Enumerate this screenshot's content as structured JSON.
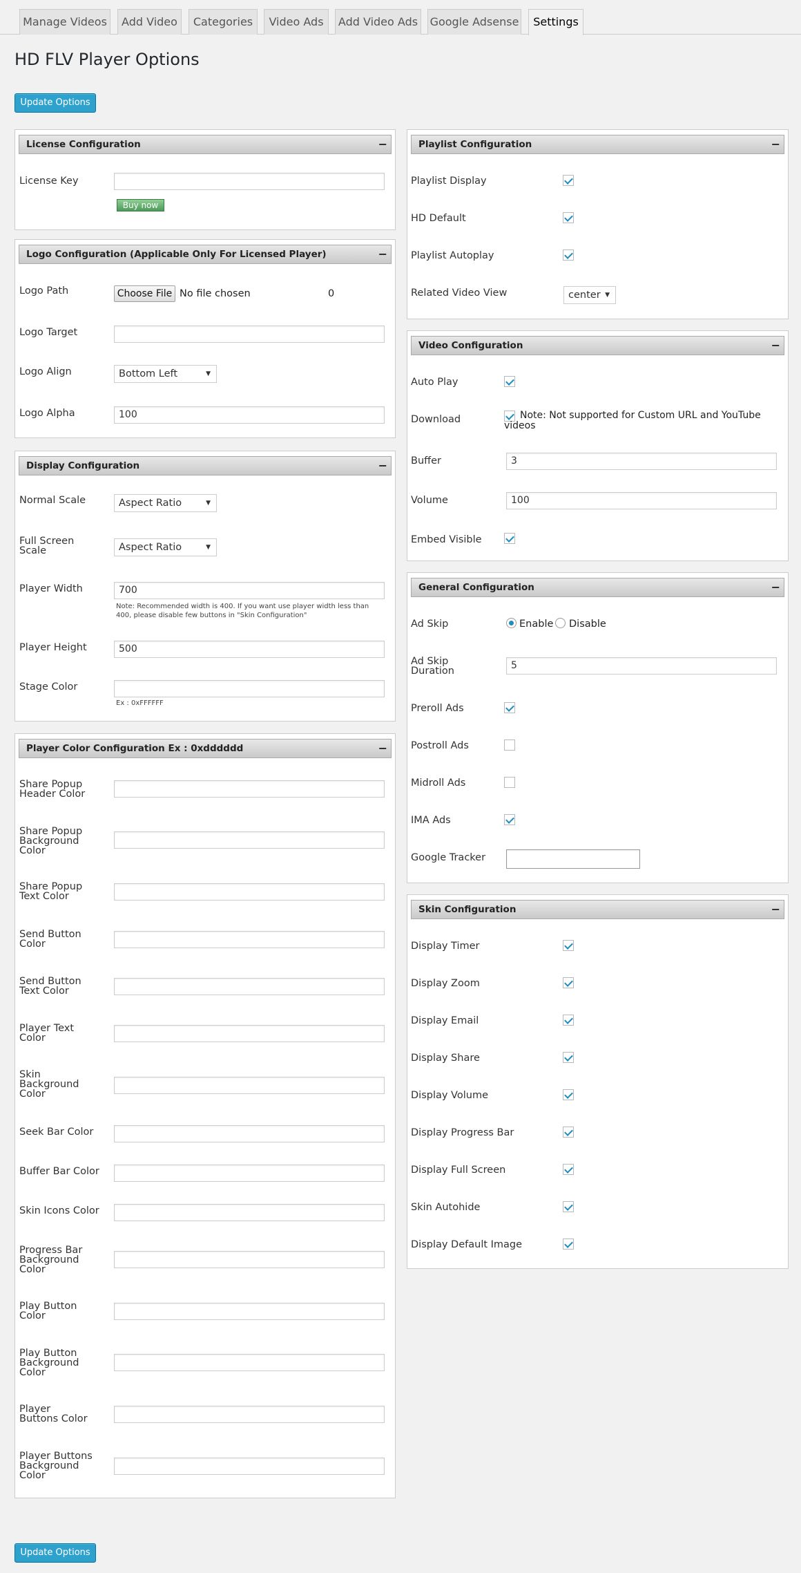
{
  "tabs": [
    "Manage Videos",
    "Add Video",
    "Categories",
    "Video Ads",
    "Add Video Ads",
    "Google Adsense",
    "Settings"
  ],
  "title": "HD FLV Player Options",
  "update_label": "Update Options",
  "license": {
    "title": "License Configuration",
    "key_label": "License Key",
    "key_value": "",
    "buy": "Buy now"
  },
  "logo": {
    "title": "Logo Configuration (Applicable Only For Licensed Player)",
    "path_label": "Logo Path",
    "choose": "Choose File",
    "no_file": "No file chosen",
    "zero": "0",
    "target_label": "Logo Target",
    "target_value": "",
    "align_label": "Logo Align",
    "align_value": "Bottom Left",
    "alpha_label": "Logo Alpha",
    "alpha_value": "100"
  },
  "display": {
    "title": "Display Configuration",
    "normal_label": "Normal Scale",
    "normal_value": "Aspect Ratio",
    "full_label": "Full Screen Scale",
    "full_value": "Aspect Ratio",
    "width_label": "Player Width",
    "width_value": "700",
    "width_note": "Note: Recommended width is 400. If you want use player width less than 400, please disable few buttons in \"Skin Configuration\"",
    "height_label": "Player Height",
    "height_value": "500",
    "stage_label": "Stage Color",
    "stage_value": "",
    "stage_note": "Ex : 0xFFFFFF"
  },
  "colors": {
    "title": "Player Color Configuration Ex : 0xdddddd",
    "items": [
      "Share Popup Header Color",
      "Share Popup Background Color",
      "Share Popup Text Color",
      "Send Button Color",
      "Send Button Text Color",
      "Player Text Color",
      "Skin Background Color",
      "Seek Bar Color",
      "Buffer Bar Color",
      "Skin Icons Color",
      "Progress Bar Background Color",
      "Play Button Color",
      "Play Button Background Color",
      "Player Buttons Color",
      "Player Buttons Background Color"
    ]
  },
  "playlist": {
    "title": "Playlist Configuration",
    "items": [
      {
        "label": "Playlist Display",
        "checked": true
      },
      {
        "label": "HD Default",
        "checked": true
      },
      {
        "label": "Playlist Autoplay",
        "checked": true
      }
    ],
    "related_label": "Related Video View",
    "related_value": "center"
  },
  "video": {
    "title": "Video Configuration",
    "autoplay_label": "Auto Play",
    "download_label": "Download",
    "download_note": "Note: Not supported for Custom URL and YouTube videos",
    "buffer_label": "Buffer",
    "buffer_value": "3",
    "volume_label": "Volume",
    "volume_value": "100",
    "embed_label": "Embed Visible"
  },
  "general": {
    "title": "General Configuration",
    "adskip_label": "Ad Skip",
    "enable": "Enable",
    "disable": "Disable",
    "duration_label": "Ad Skip Duration",
    "duration_value": "5",
    "preroll": "Preroll Ads",
    "postroll": "Postroll Ads",
    "midroll": "Midroll Ads",
    "ima": "IMA Ads",
    "tracker_label": "Google Tracker",
    "tracker_value": ""
  },
  "skin": {
    "title": "Skin Configuration",
    "items": [
      "Display Timer",
      "Display Zoom",
      "Display Email",
      "Display Share",
      "Display Volume",
      "Display Progress Bar",
      "Display Full Screen",
      "Skin Autohide",
      "Display Default Image"
    ]
  }
}
